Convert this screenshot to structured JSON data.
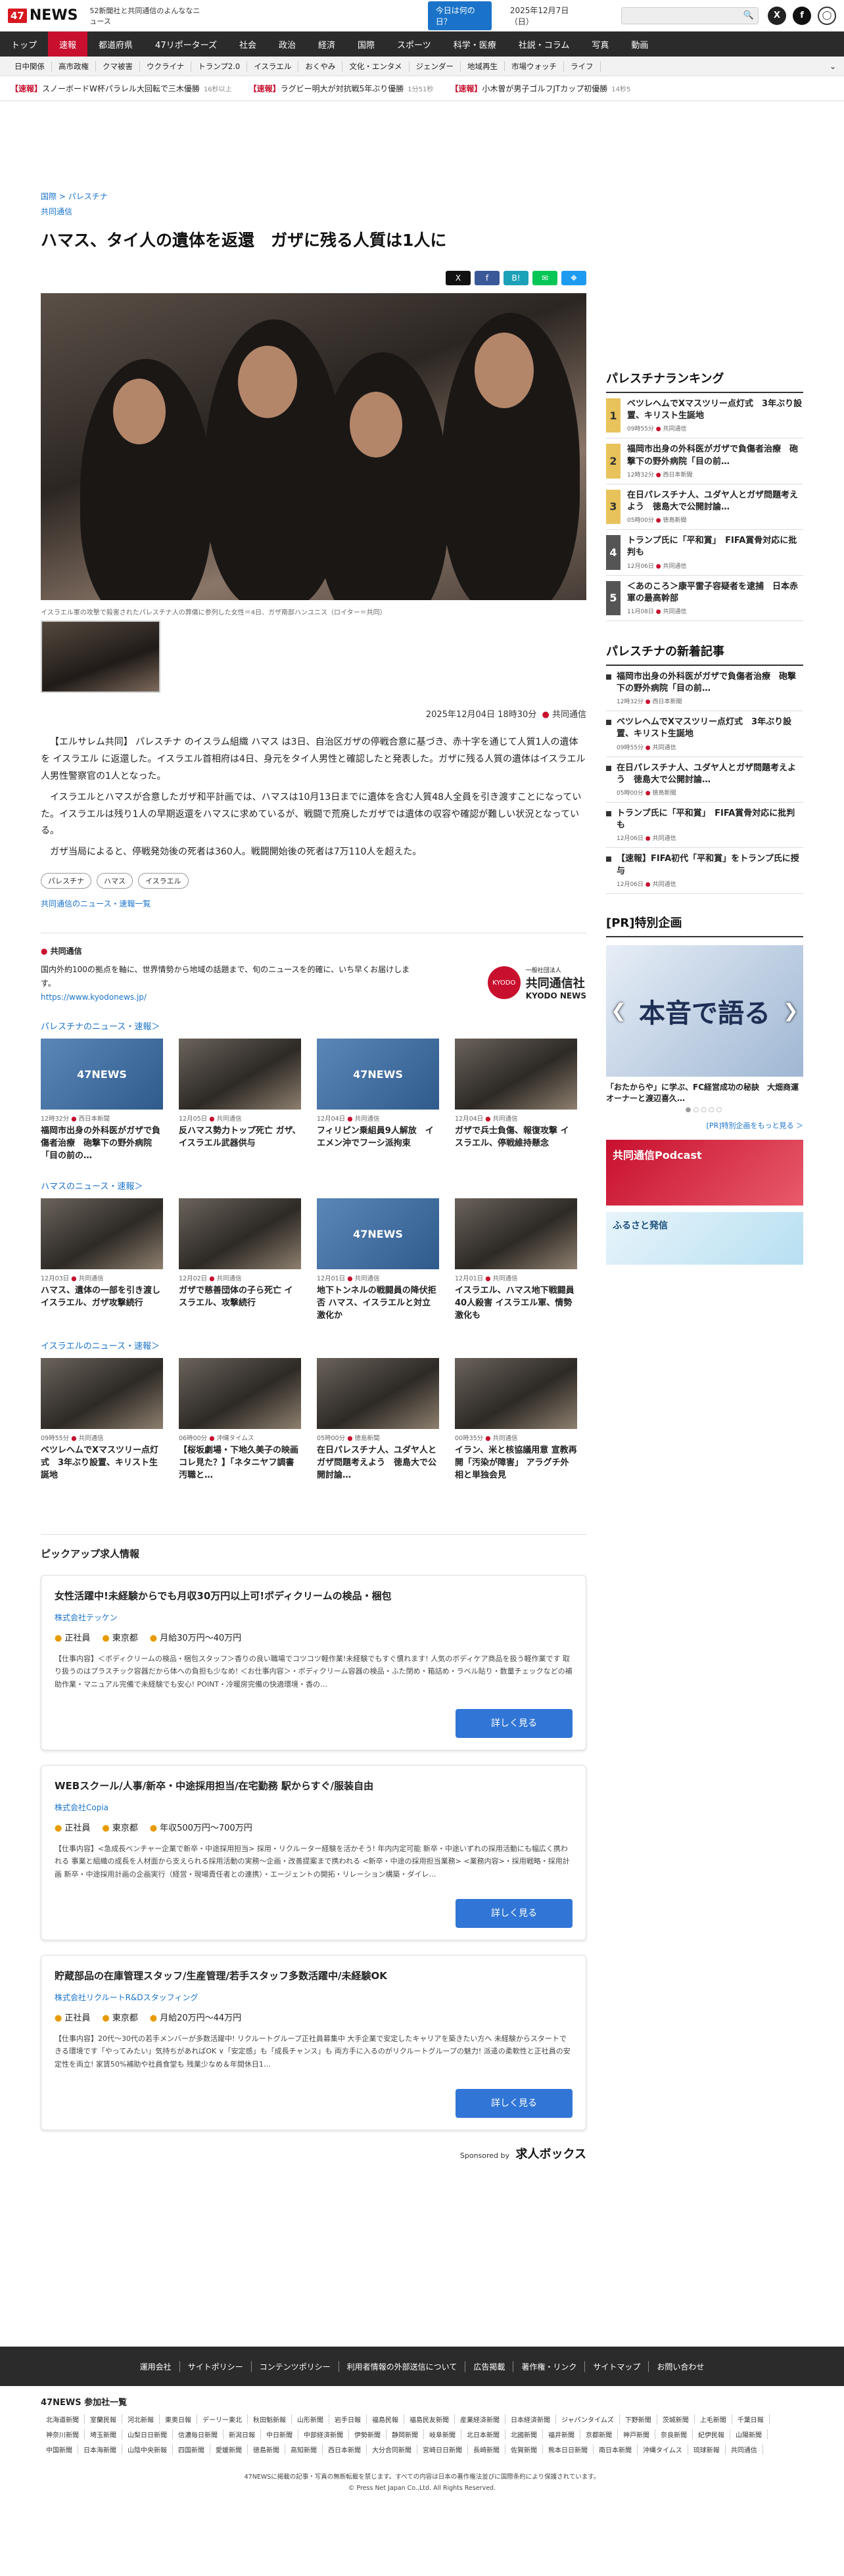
{
  "header": {
    "logo_mark": "47",
    "logo_text": "NEWS",
    "tagline": "52新聞社と共同通信のよんななニュース",
    "today_label": "今日は何の日？",
    "date": "2025年12月7日（日）",
    "search_placeholder": ""
  },
  "nav": [
    "トップ",
    "速報",
    "都道府県",
    "47リポーターズ",
    "社会",
    "政治",
    "経済",
    "国際",
    "スポーツ",
    "科学・医療",
    "社説・コラム",
    "写真",
    "動画"
  ],
  "subnav": [
    "日中関係",
    "高市政権",
    "クマ被害",
    "ウクライナ",
    "トランプ2.0",
    "イスラエル",
    "おくやみ",
    "文化・エンタメ",
    "ジェンダー",
    "地域再生",
    "市場ウォッチ",
    "ライフ"
  ],
  "ticker": [
    {
      "label": "【速報】",
      "text": "スノーボードW杯パラレル大回転で三木優勝",
      "ago": "16秒以上"
    },
    {
      "label": "【速報】",
      "text": "ラグビー明大が対抗戦5年ぶり優勝",
      "ago": "1分51秒"
    },
    {
      "label": "【速報】",
      "text": "小木曽が男子ゴルフJTカップ初優勝",
      "ago": "14秒5"
    }
  ],
  "article": {
    "crumb1": "国際",
    "crumb2": "パレスチナ",
    "source_link": "共同通信",
    "title": "ハマス、タイ人の遺体を返還　ガザに残る人質は1人に",
    "caption": "イスラエル軍の攻撃で殺害されたパレスチナ人の葬儀に参列した女性＝4日、ガザ南部ハンユニス（ロイター＝共同）",
    "datetime": "2025年12月04日 18時30分",
    "agency": "共同通信",
    "paragraphs": [
      "【エルサレム共同】 パレスチナ のイスラム組織 ハマス は3日、自治区ガザの停戦合意に基づき、赤十字を通じて人質1人の遺体を イスラエル に返還した。イスラエル首相府は4日、身元をタイ人男性と確認したと発表した。ガザに残る人質の遺体はイスラエル人男性警察官の1人となった。",
      "イスラエルとハマスが合意したガザ和平計画では、ハマスは10月13日までに遺体を含む人質48人全員を引き渡すことになっていた。イスラエルは残り1人の早期返還をハマスに求めているが、戦闘で荒廃したガザでは遺体の収容や確認が難しい状況となっている。",
      "ガザ当局によると、停戦発効後の死者は360人。戦闘開始後の死者は7万110人を超えた。"
    ],
    "tags": [
      "パレスチナ",
      "ハマス",
      "イスラエル"
    ],
    "more_link": "共同通信のニュース・速報一覧"
  },
  "source": {
    "name": "共同通信",
    "desc": "国内外約100の拠点を軸に、世界情勢から地域の話題まで、旬のニュースを的確に、いち早くお届けします。",
    "url": "https://www.kyodonews.jp/",
    "logo_circle": "KYODO",
    "logo_jp": "共同通信社",
    "logo_en": "KYODO NEWS",
    "logo_small": "一般社団法人"
  },
  "sections": [
    {
      "title": "パレスチナのニュース・速報＞",
      "cards": [
        {
          "time": "12時32分",
          "src": "西日本新聞",
          "title": "福岡市出身の外科医がガザで負傷者治療　砲撃下の野外病院「目の前の…",
          "img": "47NEWS"
        },
        {
          "time": "12月05日",
          "src": "共同通信",
          "title": "反ハマス勢力トップ死亡 ガザ、イスラエル武器供与",
          "img": ""
        },
        {
          "time": "12月04日",
          "src": "共同通信",
          "title": "フィリピン乗組員9人解放　イエメン沖でフーシ派拘束",
          "img": "47NEWS"
        },
        {
          "time": "12月04日",
          "src": "共同通信",
          "title": "ガザで兵士負傷、報復攻撃 イスラエル、停戦維持懸念",
          "img": ""
        }
      ]
    },
    {
      "title": "ハマスのニュース・速報＞",
      "cards": [
        {
          "time": "12月03日",
          "src": "共同通信",
          "title": "ハマス、遺体の一部を引き渡し　イスラエル、ガザ攻撃続行",
          "img": ""
        },
        {
          "time": "12月02日",
          "src": "共同通信",
          "title": "ガザで慈善団体の子ら死亡 イスラエル、攻撃続行",
          "img": ""
        },
        {
          "time": "12月01日",
          "src": "共同通信",
          "title": "地下トンネルの戦闘員の降伏拒否 ハマス、イスラエルと対立激化か",
          "img": "47NEWS"
        },
        {
          "time": "12月01日",
          "src": "共同通信",
          "title": "イスラエル、ハマス地下戦闘員40人殺害 イスラエル軍、情勢激化も",
          "img": ""
        }
      ]
    },
    {
      "title": "イスラエルのニュース・速報＞",
      "cards": [
        {
          "time": "09時55分",
          "src": "共同通信",
          "title": "ベツレヘムでXマスツリー点灯式　3年ぶり設置、キリスト生誕地",
          "img": ""
        },
        {
          "time": "06時00分",
          "src": "沖縄タイムス",
          "title": "【桜坂劇場・下地久美子の映画コレ見た？】「ネタニヤフ調書　汚職と…",
          "img": ""
        },
        {
          "time": "05時00分",
          "src": "徳島新聞",
          "title": "在日パレスチナ人、ユダヤ人と ガザ問題考えよう　徳島大で公開討論…",
          "img": ""
        },
        {
          "time": "00時35分",
          "src": "共同通信",
          "title": "イラン、米と核協議用意 宣教再開「汚染が障害」 アラグチ外相と単独会見",
          "img": ""
        }
      ]
    }
  ],
  "jobs": {
    "heading": "ピックアップ求人情報",
    "button": "詳しく見る",
    "items": [
      {
        "title": "女性活躍中!未経験からでも月収30万円以上可!ボディクリームの検品・梱包",
        "company": "株式会社テッケン",
        "type": "正社員",
        "place": "東京都",
        "pay": "月給30万円〜40万円",
        "desc": "【仕事内容】＜ボディクリームの検品・梱包スタッフ＞香りの良い職場でコツコツ軽作業!未経験でもすぐ慣れます! 人気のボディケア商品を扱う軽作業です 取り扱うのはプラスチック容器だから体への負担も少なめ! ＜お仕事内容＞・ボディクリーム容器の検品・ふた閉め・箱詰め・ラベル貼り・数量チェックなどの補助作業・マニュアル完備で未経験でも安心! POINT・冷暖房完備の快適環境・香の…"
      },
      {
        "title": "WEBスクール/人事/新卒・中途採用担当/在宅勤務 駅からすぐ/服装自由",
        "company": "株式会社Copia",
        "type": "正社員",
        "place": "東京都",
        "pay": "年収500万円〜700万円",
        "desc": "【仕事内容】<急成長ベンチャー企業で新卒・中途採用担当> 採用・リクルーター経験を活かそう! 年内内定可能 新卒・中途いずれの採用活動にも幅広く携われる 事業と組織の成長を人材面から支えられる採用活動の実務〜企画・改善提案まで携われる <新卒・中途の採用担当業務> <業務内容>・採用戦略・採用計画 新卒・中途採用計画の企画実行（経営・現場責任者との連携）・エージェントの開拓・リレーション構築・ダイレ…"
      },
      {
        "title": "貯蔵部品の在庫管理スタッフ/生産管理/若手スタッフ多数活躍中/未経験OK",
        "company": "株式会社リクルートR&Dスタッフィング",
        "type": "正社員",
        "place": "東京都",
        "pay": "月給20万円〜44万円",
        "desc": "【仕事内容】20代〜30代の若手メンバーが多数活躍中! リクルートグループ正社員募集中 大手企業で安定したキャリアを築きたい方へ 未経験からスタートできる環境です「やってみたい」気持ちがあればOK ∨「安定感」も「成長チャンス」も 両方手に入るのがリクルートグループの魅力! 派遣の柔軟性と正社員の安定性を両立! 家賃50%補助や社員食堂も 残業少なめ＆年間休日1…"
      }
    ],
    "sponsor_label": "Sponsored by",
    "sponsor_name": "求人ボックス"
  },
  "sidebar": {
    "ranking_title": "パレスチナランキング",
    "ranking": [
      {
        "n": "1",
        "title": "ベツレヘムでXマスツリー点灯式　3年ぶり設置、キリスト生誕地",
        "time": "09時55分",
        "src": "共同通信"
      },
      {
        "n": "2",
        "title": "福岡市出身の外科医がガザで負傷者治療　砲撃下の野外病院「目の前…",
        "time": "12時32分",
        "src": "西日本新聞"
      },
      {
        "n": "3",
        "title": "在日パレスチナ人、ユダヤ人とガザ問題考えよう　徳島大で公開討論…",
        "time": "05時00分",
        "src": "徳島新聞"
      },
      {
        "n": "4",
        "title": "トランプ氏に「平和賞」　FIFA賞骨対応に批判も",
        "time": "12月06日",
        "src": "共同通信"
      },
      {
        "n": "5",
        "title": "＜あのころ＞康平雷子容疑者を逮捕　日本赤軍の最高幹部",
        "time": "11月08日",
        "src": "共同通信"
      }
    ],
    "new_title": "パレスチナの新着記事",
    "new": [
      {
        "title": "福岡市出身の外科医がガザで負傷者治療　砲撃下の野外病院「目の前…",
        "time": "12時32分",
        "src": "西日本新聞"
      },
      {
        "title": "ベツレヘムでXマスツリー点灯式　3年ぶり設置、キリスト生誕地",
        "time": "09時55分",
        "src": "共同通信"
      },
      {
        "title": "在日パレスチナ人、ユダヤ人とガザ問題考えよう　徳島大で公開討論…",
        "time": "05時00分",
        "src": "徳島新聞"
      },
      {
        "title": "トランプ氏に「平和賞」　FIFA賞骨対応に批判も",
        "time": "12月06日",
        "src": "共同通信"
      },
      {
        "title": "【速報】FIFA初代「平和賞」をトランプ氏に授与",
        "time": "12月06日",
        "src": "共同通信"
      }
    ],
    "pr_title": "[PR]特別企画",
    "pr_image_text": "本音で語る",
    "pr_caption": "「おたからや」に学ぶ、FC経営成功の秘訣　大畑商運オーナーと渡辺喜久…",
    "pr_more": "[PR]特別企画をもっと見る ＞",
    "banner1": "共同通信Podcast",
    "banner2": "ふるさと発信"
  },
  "footer": {
    "links": [
      "運用会社",
      "サイトポリシー",
      "コンテンツポリシー",
      "利用者情報の外部送信について",
      "広告掲載",
      "著作権・リンク",
      "サイトマップ",
      "お問い合わせ"
    ],
    "title": "47NEWS 参加社一覧",
    "members": [
      "北海道新聞",
      "室蘭民報",
      "河北新報",
      "東奥日報",
      "デーリー東北",
      "秋田魁新報",
      "山形新聞",
      "岩手日報",
      "福島民報",
      "福島民友新聞",
      "産業経済新聞",
      "日本経済新聞",
      "ジャパンタイムズ",
      "下野新聞",
      "茨城新聞",
      "上毛新聞",
      "千葉日報",
      "神奈川新聞",
      "埼玉新聞",
      "山梨日日新聞",
      "信濃毎日新聞",
      "新潟日報",
      "中日新聞",
      "中部経済新聞",
      "伊勢新聞",
      "静岡新聞",
      "岐阜新聞",
      "北日本新聞",
      "北國新聞",
      "福井新聞",
      "京都新聞",
      "神戸新聞",
      "奈良新聞",
      "紀伊民報",
      "山陽新聞",
      "中国新聞",
      "日本海新聞",
      "山陰中央新報",
      "四国新聞",
      "愛媛新聞",
      "徳島新聞",
      "高知新聞",
      "西日本新聞",
      "大分合同新聞",
      "宮崎日日新聞",
      "長崎新聞",
      "佐賀新聞",
      "熊本日日新聞",
      "南日本新聞",
      "沖縄タイムス",
      "琉球新報",
      "共同通信"
    ],
    "note": "47NEWSに掲載の記事・写真の無断転載を禁じます。すべての内容は日本の著作権法並びに国際条約により保護されています。",
    "copy": "© Press Net Japan Co.,Ltd. All Rights Reserved."
  }
}
